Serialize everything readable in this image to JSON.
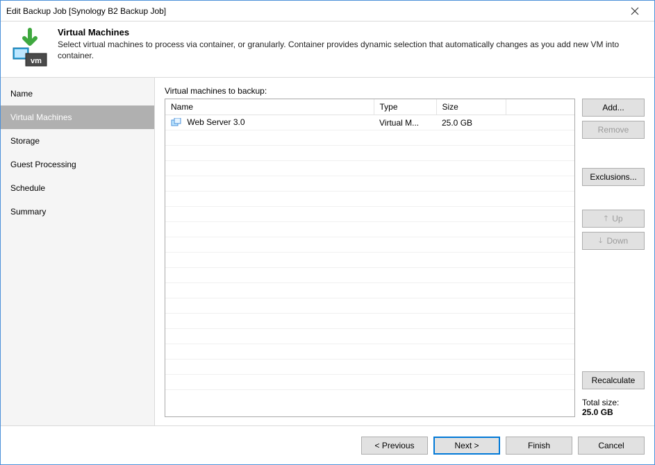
{
  "window": {
    "title": "Edit Backup Job [Synology B2 Backup Job]"
  },
  "header": {
    "title": "Virtual Machines",
    "description": "Select virtual machines to process via container, or granularly. Container provides dynamic selection that automatically changes as you add new VM into container."
  },
  "sidebar": {
    "items": [
      {
        "label": "Name",
        "active": false
      },
      {
        "label": "Virtual Machines",
        "active": true
      },
      {
        "label": "Storage",
        "active": false
      },
      {
        "label": "Guest Processing",
        "active": false
      },
      {
        "label": "Schedule",
        "active": false
      },
      {
        "label": "Summary",
        "active": false
      }
    ]
  },
  "main": {
    "list_label": "Virtual machines to backup:",
    "columns": {
      "name": "Name",
      "type": "Type",
      "size": "Size"
    },
    "rows": [
      {
        "name": "Web Server 3.0",
        "type": "Virtual M...",
        "size": "25.0 GB"
      }
    ],
    "total_label": "Total size:",
    "total_value": "25.0 GB"
  },
  "buttons": {
    "add": "Add...",
    "remove": "Remove",
    "exclusions": "Exclusions...",
    "up": "Up",
    "down": "Down",
    "recalculate": "Recalculate"
  },
  "footer": {
    "previous": "< Previous",
    "next": "Next >",
    "finish": "Finish",
    "cancel": "Cancel"
  }
}
